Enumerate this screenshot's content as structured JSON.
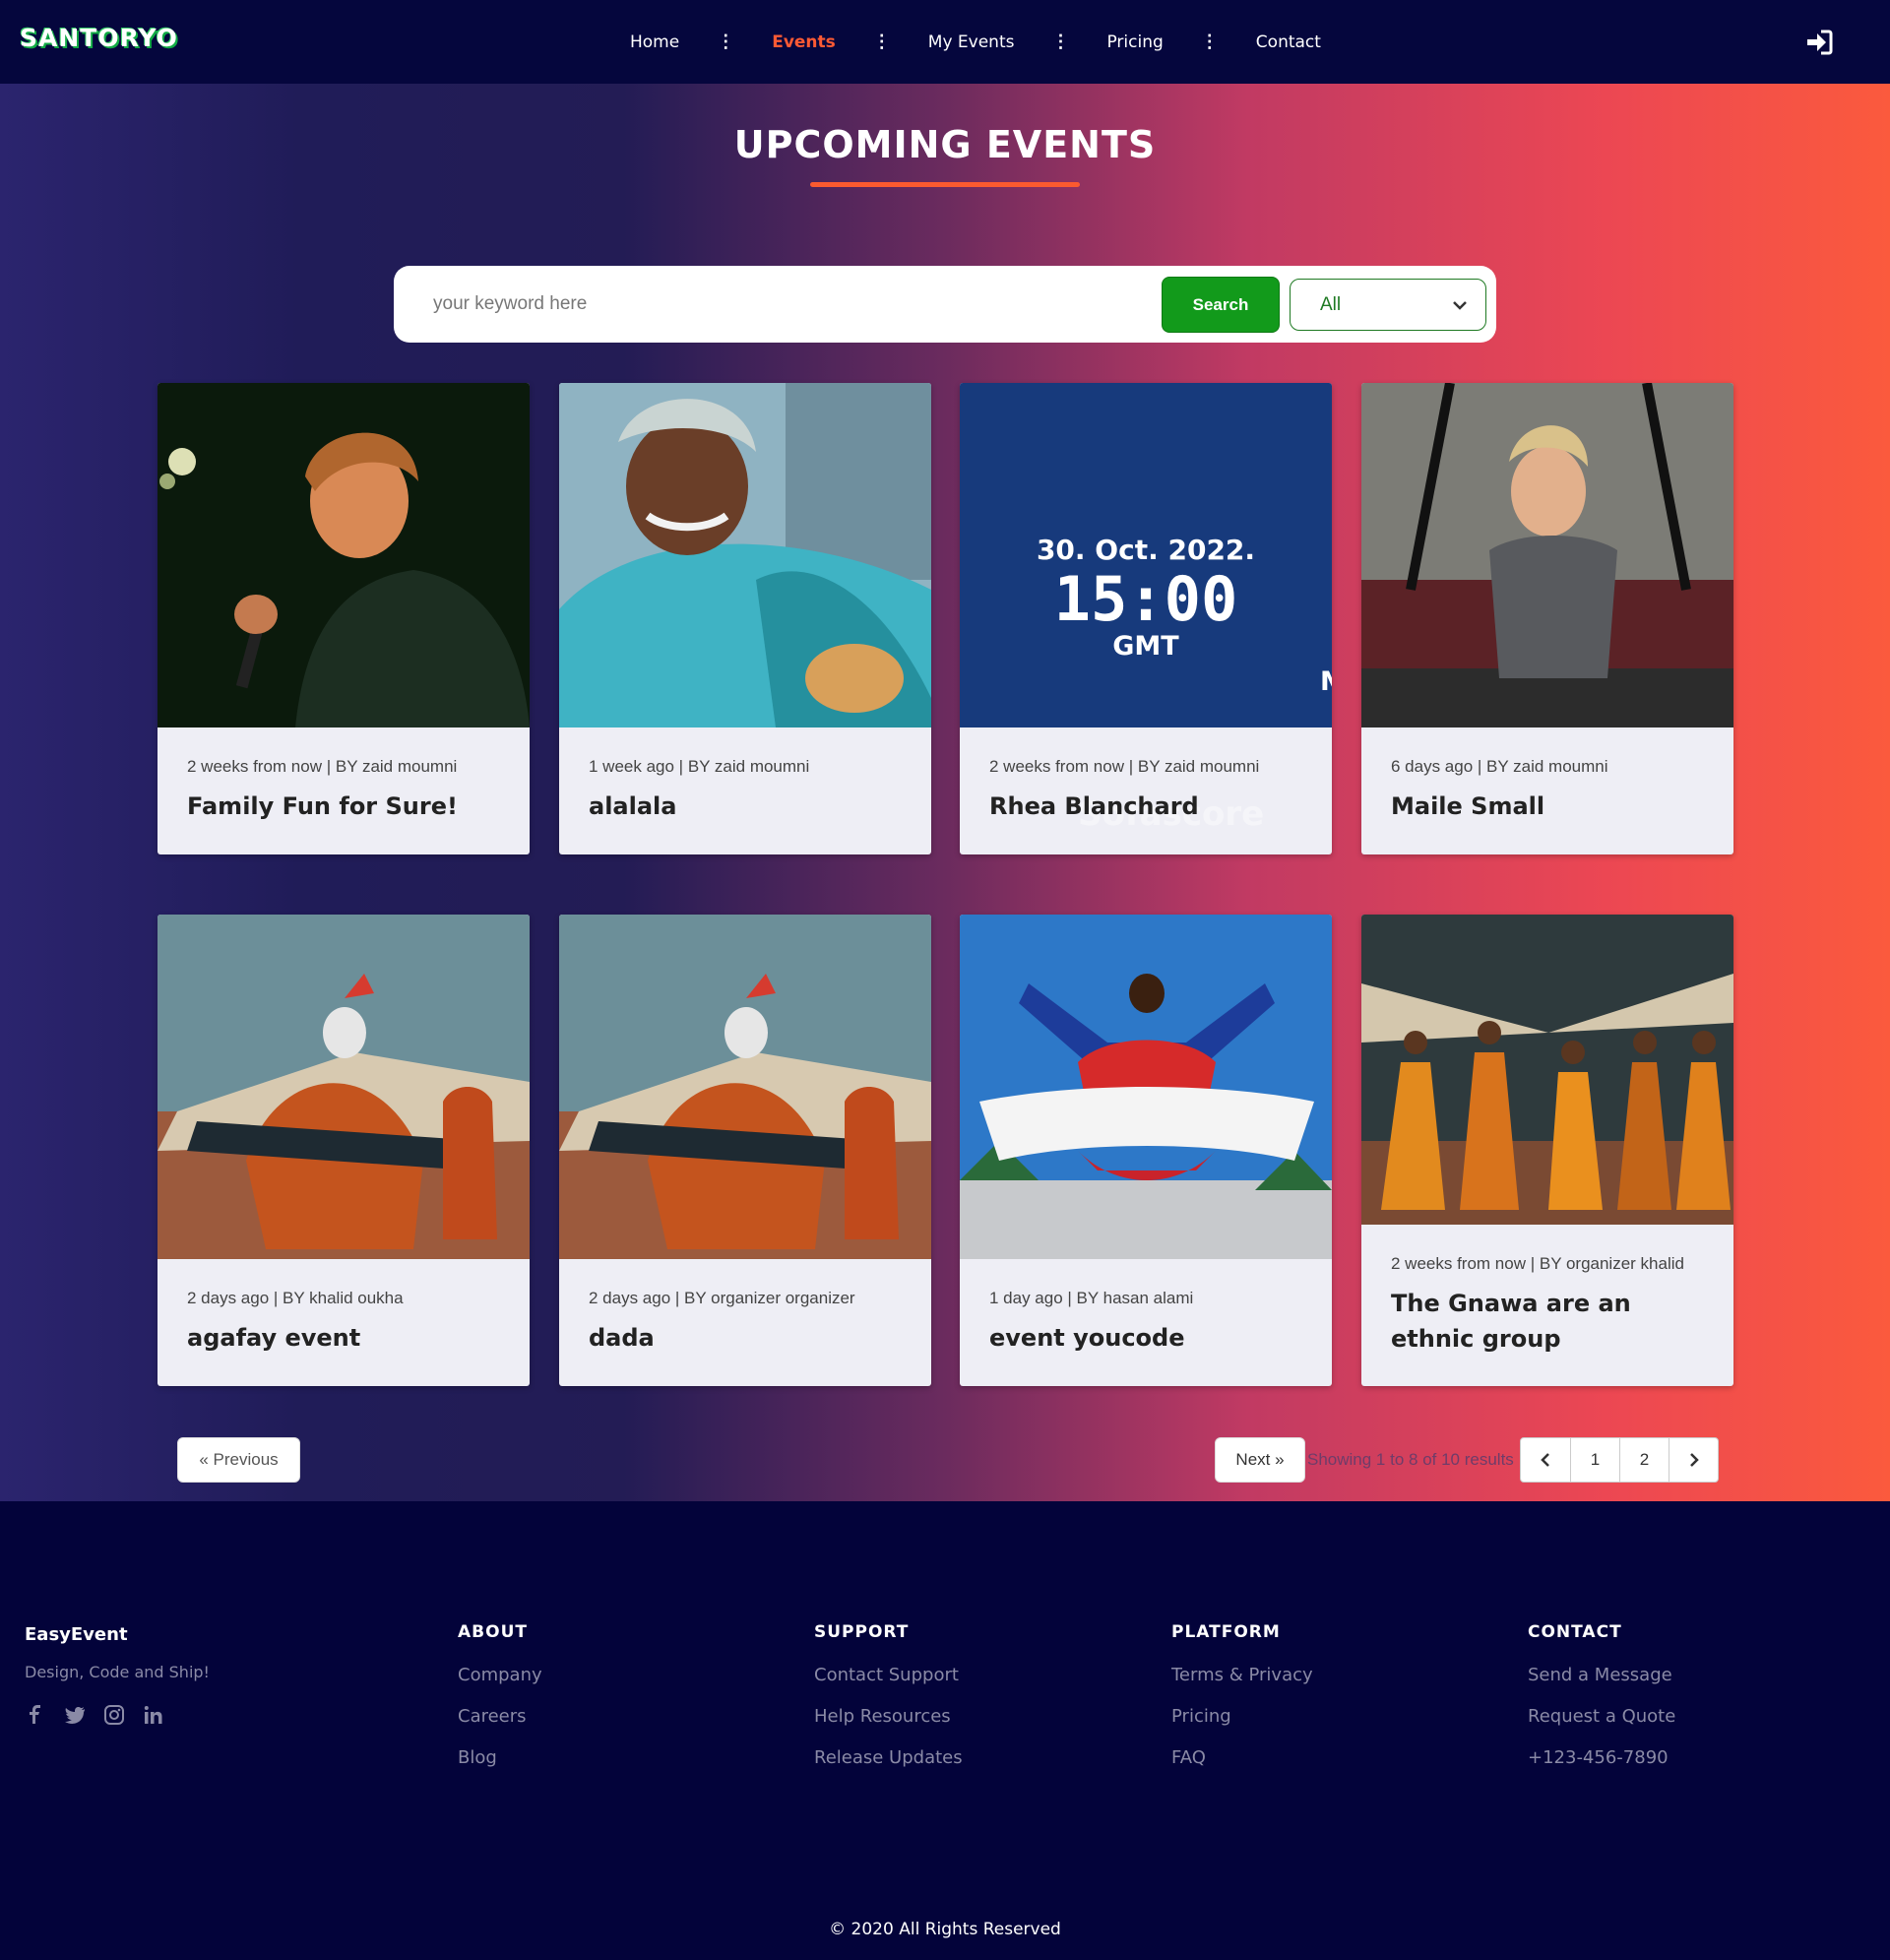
{
  "nav": {
    "logo": "SANTORYO",
    "items": [
      {
        "label": "Home",
        "active": false
      },
      {
        "label": "Events",
        "active": true
      },
      {
        "label": "My Events",
        "active": false
      },
      {
        "label": "Pricing",
        "active": false
      },
      {
        "label": "Contact",
        "active": false
      }
    ],
    "login_icon": "sign-in-icon"
  },
  "hero": {
    "title": "UPCOMING EVENTS"
  },
  "search": {
    "placeholder": "your keyword here",
    "button_label": "Search",
    "filter_value": "All"
  },
  "events": [
    {
      "meta": "2 weeks from now | BY zaid moumni",
      "title": "Family Fun for Sure!",
      "image": "singer-on-stage-photo"
    },
    {
      "meta": "1 week ago | BY zaid moumni",
      "title": "alalala",
      "image": "gnawa-musician-photo"
    },
    {
      "meta": "2 weeks from now | BY zaid moumni",
      "title": "Rhea Blanchard",
      "image": "match-date-poster",
      "poster": {
        "date": "30. Oct. 2022.",
        "time": "15:00",
        "zone": "GMT",
        "edge_letter": "M",
        "watermark": "Sofascore"
      }
    },
    {
      "meta": "6 days ago | BY zaid moumni",
      "title": "Maile Small",
      "image": "fitness-workout-photo"
    },
    {
      "meta": "2 days ago | BY khalid oukha",
      "title": "agafay event",
      "image": "gnawa-dancer-photo"
    },
    {
      "meta": "2 days ago | BY organizer organizer",
      "title": "dada",
      "image": "gnawa-dancer-photo"
    },
    {
      "meta": "1 day ago | BY hasan alami",
      "title": "event youcode",
      "image": "jumping-performer-photo"
    },
    {
      "meta": "2 weeks from now | BY organizer khalid",
      "title": "The Gnawa are an ethnic group",
      "image": "gnawa-group-photo"
    }
  ],
  "pagination": {
    "prev_label": "« Previous",
    "next_label": "Next »",
    "results_text": "Showing 1 to 8 of 10 results",
    "pages": [
      "1",
      "2"
    ]
  },
  "footer": {
    "brand": "EasyEvent",
    "tagline": "Design, Code and Ship!",
    "socials": [
      "facebook-icon",
      "twitter-icon",
      "instagram-icon",
      "linkedin-icon"
    ],
    "columns": [
      {
        "heading": "ABOUT",
        "links": [
          "Company",
          "Careers",
          "Blog"
        ]
      },
      {
        "heading": "SUPPORT",
        "links": [
          "Contact Support",
          "Help Resources",
          "Release Updates"
        ]
      },
      {
        "heading": "PLATFORM",
        "links": [
          "Terms & Privacy",
          "Pricing",
          "FAQ"
        ]
      },
      {
        "heading": "CONTACT",
        "links": [
          "Send a Message",
          "Request a Quote",
          "+123-456-7890"
        ]
      }
    ],
    "copyright": "© 2020 All Rights Reserved"
  },
  "colors": {
    "nav_bg": "#05063d",
    "accent": "#fd5a34",
    "search_button": "#129a1b",
    "footer_bg": "#03033a"
  }
}
